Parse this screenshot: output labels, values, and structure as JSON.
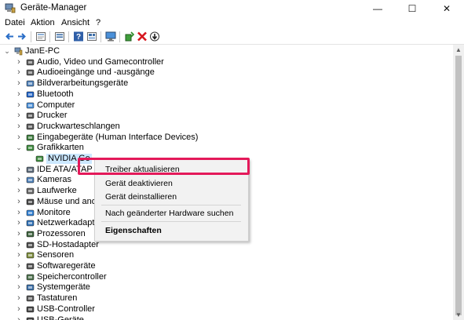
{
  "window": {
    "title": "Geräte-Manager",
    "minimize_glyph": "—",
    "maximize_glyph": "☐",
    "close_glyph": "✕"
  },
  "menu": [
    "Datei",
    "Aktion",
    "Ansicht",
    "?"
  ],
  "toolbar": [
    "back-icon",
    "forward-icon",
    "properties-icon",
    "list-icon",
    "help-icon",
    "view-icon",
    "monitor-icon",
    "enable-driver-icon",
    "uninstall-icon",
    "update-driver-icon"
  ],
  "tree": {
    "root": "JanE-PC",
    "items": [
      {
        "label": "Audio, Video und Gamecontroller",
        "icon": "speaker-icon",
        "expanded": false
      },
      {
        "label": "Audioeingänge und -ausgänge",
        "icon": "speaker-icon",
        "expanded": false
      },
      {
        "label": "Bildverarbeitungsgeräte",
        "icon": "camera-icon",
        "expanded": false
      },
      {
        "label": "Bluetooth",
        "icon": "bluetooth-icon",
        "expanded": false
      },
      {
        "label": "Computer",
        "icon": "computer-icon",
        "expanded": false
      },
      {
        "label": "Drucker",
        "icon": "printer-icon",
        "expanded": false
      },
      {
        "label": "Druckwarteschlangen",
        "icon": "printer-icon",
        "expanded": false
      },
      {
        "label": "Eingabegeräte (Human Interface Devices)",
        "icon": "hid-icon",
        "expanded": false
      },
      {
        "label": "Grafikkarten",
        "icon": "display-adapter-icon",
        "expanded": true
      },
      {
        "label": "NVIDIA Ge",
        "icon": "display-adapter-icon",
        "child": true,
        "selected": true
      },
      {
        "label": "IDE ATA/ATAP",
        "icon": "ide-icon",
        "expanded": false
      },
      {
        "label": "Kameras",
        "icon": "camera-icon",
        "expanded": false
      },
      {
        "label": "Laufwerke",
        "icon": "drive-icon",
        "expanded": false
      },
      {
        "label": "Mäuse und and",
        "icon": "mouse-icon",
        "expanded": false
      },
      {
        "label": "Monitore",
        "icon": "monitor-icon",
        "expanded": false
      },
      {
        "label": "Netzwerkadapt",
        "icon": "network-icon",
        "expanded": false
      },
      {
        "label": "Prozessoren",
        "icon": "processor-icon",
        "expanded": false
      },
      {
        "label": "SD-Hostadapter",
        "icon": "sd-card-icon",
        "expanded": false
      },
      {
        "label": "Sensoren",
        "icon": "sensor-icon",
        "expanded": false
      },
      {
        "label": "Softwaregeräte",
        "icon": "software-device-icon",
        "expanded": false
      },
      {
        "label": "Speichercontroller",
        "icon": "storage-controller-icon",
        "expanded": false
      },
      {
        "label": "Systemgeräte",
        "icon": "system-device-icon",
        "expanded": false
      },
      {
        "label": "Tastaturen",
        "icon": "keyboard-icon",
        "expanded": false
      },
      {
        "label": "USB-Controller",
        "icon": "usb-icon",
        "expanded": false
      },
      {
        "label": "USB-Geräte",
        "icon": "usb-icon",
        "expanded": false
      }
    ]
  },
  "context_menu": {
    "items": [
      {
        "label": "Treiber aktualisieren",
        "highlighted": true
      },
      {
        "label": "Gerät deaktivieren"
      },
      {
        "label": "Gerät deinstallieren"
      },
      {
        "label": "Nach geänderter Hardware suchen"
      },
      {
        "label": "Eigenschaften",
        "bold": true
      }
    ]
  },
  "colors": {
    "highlight_border": "#e4195a",
    "selection_bg": "#cce8ff",
    "menu_bg": "#f2f2f2"
  }
}
